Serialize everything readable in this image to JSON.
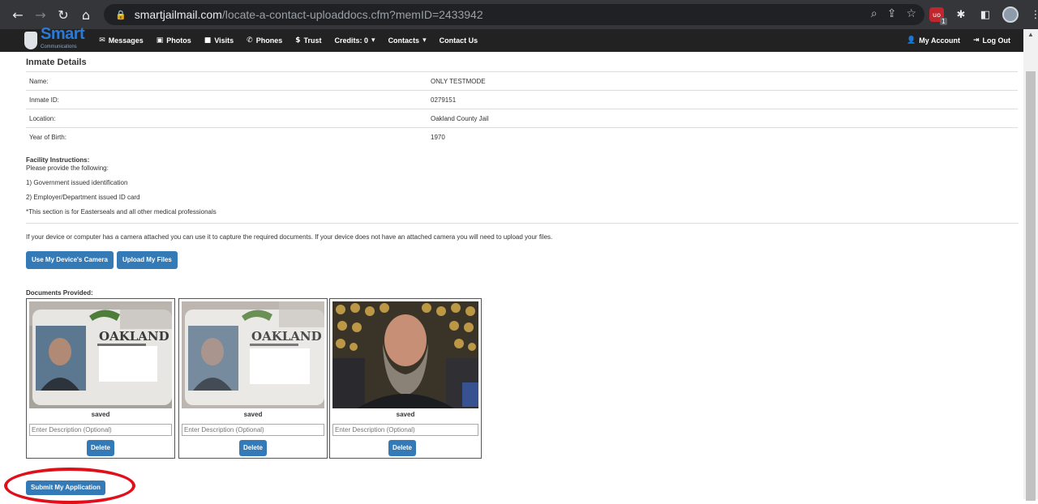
{
  "browser": {
    "url_domain": "smartjailmail.com",
    "url_path": "/locate-a-contact-uploaddocs.cfm?memID=2433942",
    "ext_badge": "1"
  },
  "nav": {
    "logo_text": "Smart",
    "logo_sub": "Communications",
    "items": [
      {
        "label": "Messages",
        "icon": "envelope-icon",
        "glyph": "✉"
      },
      {
        "label": "Photos",
        "icon": "photo-icon",
        "glyph": "▣"
      },
      {
        "label": "Visits",
        "icon": "video-icon",
        "glyph": "■"
      },
      {
        "label": "Phones",
        "icon": "phone-icon",
        "glyph": "✆"
      },
      {
        "label": "Trust",
        "icon": "dollar-icon",
        "glyph": "$"
      },
      {
        "label": "Credits: 0",
        "icon": "caret-down-icon",
        "glyph": "▾"
      },
      {
        "label": "Contacts",
        "icon": "caret-down-icon",
        "glyph": "▾"
      },
      {
        "label": "Contact Us",
        "icon": "",
        "glyph": ""
      }
    ],
    "my_account": "My Account",
    "log_out": "Log Out"
  },
  "inmate": {
    "title": "Inmate Details",
    "rows": [
      {
        "label": "Name:",
        "value": "ONLY TESTMODE"
      },
      {
        "label": "Inmate ID:",
        "value": "0279151"
      },
      {
        "label": "Location:",
        "value": "Oakland County Jail"
      },
      {
        "label": "Year of Birth:",
        "value": "1970"
      }
    ]
  },
  "facility": {
    "heading": "Facility Instructions:",
    "intro": "Please provide the following:",
    "items": [
      "1) Government issued identification",
      "2) Employer/Department issued ID card",
      "*This section is for Easterseals and all other medical professionals"
    ]
  },
  "camera_info": "If your device or computer has a camera attached you can use it to capture the required documents. If your device does not have an attached camera you will need to upload your files.",
  "buttons": {
    "camera": "Use My Device's Camera",
    "upload": "Upload My Files",
    "submit": "Submit My Application"
  },
  "documents": {
    "label": "Documents Provided:",
    "items": [
      {
        "status": "saved",
        "placeholder": "Enter Description (Optional)",
        "delete": "Delete",
        "card_text": "OAKLAND"
      },
      {
        "status": "saved",
        "placeholder": "Enter Description (Optional)",
        "delete": "Delete",
        "card_text": "OAKLAND"
      },
      {
        "status": "saved",
        "placeholder": "Enter Description (Optional)",
        "delete": "Delete",
        "card_text": ""
      }
    ]
  }
}
